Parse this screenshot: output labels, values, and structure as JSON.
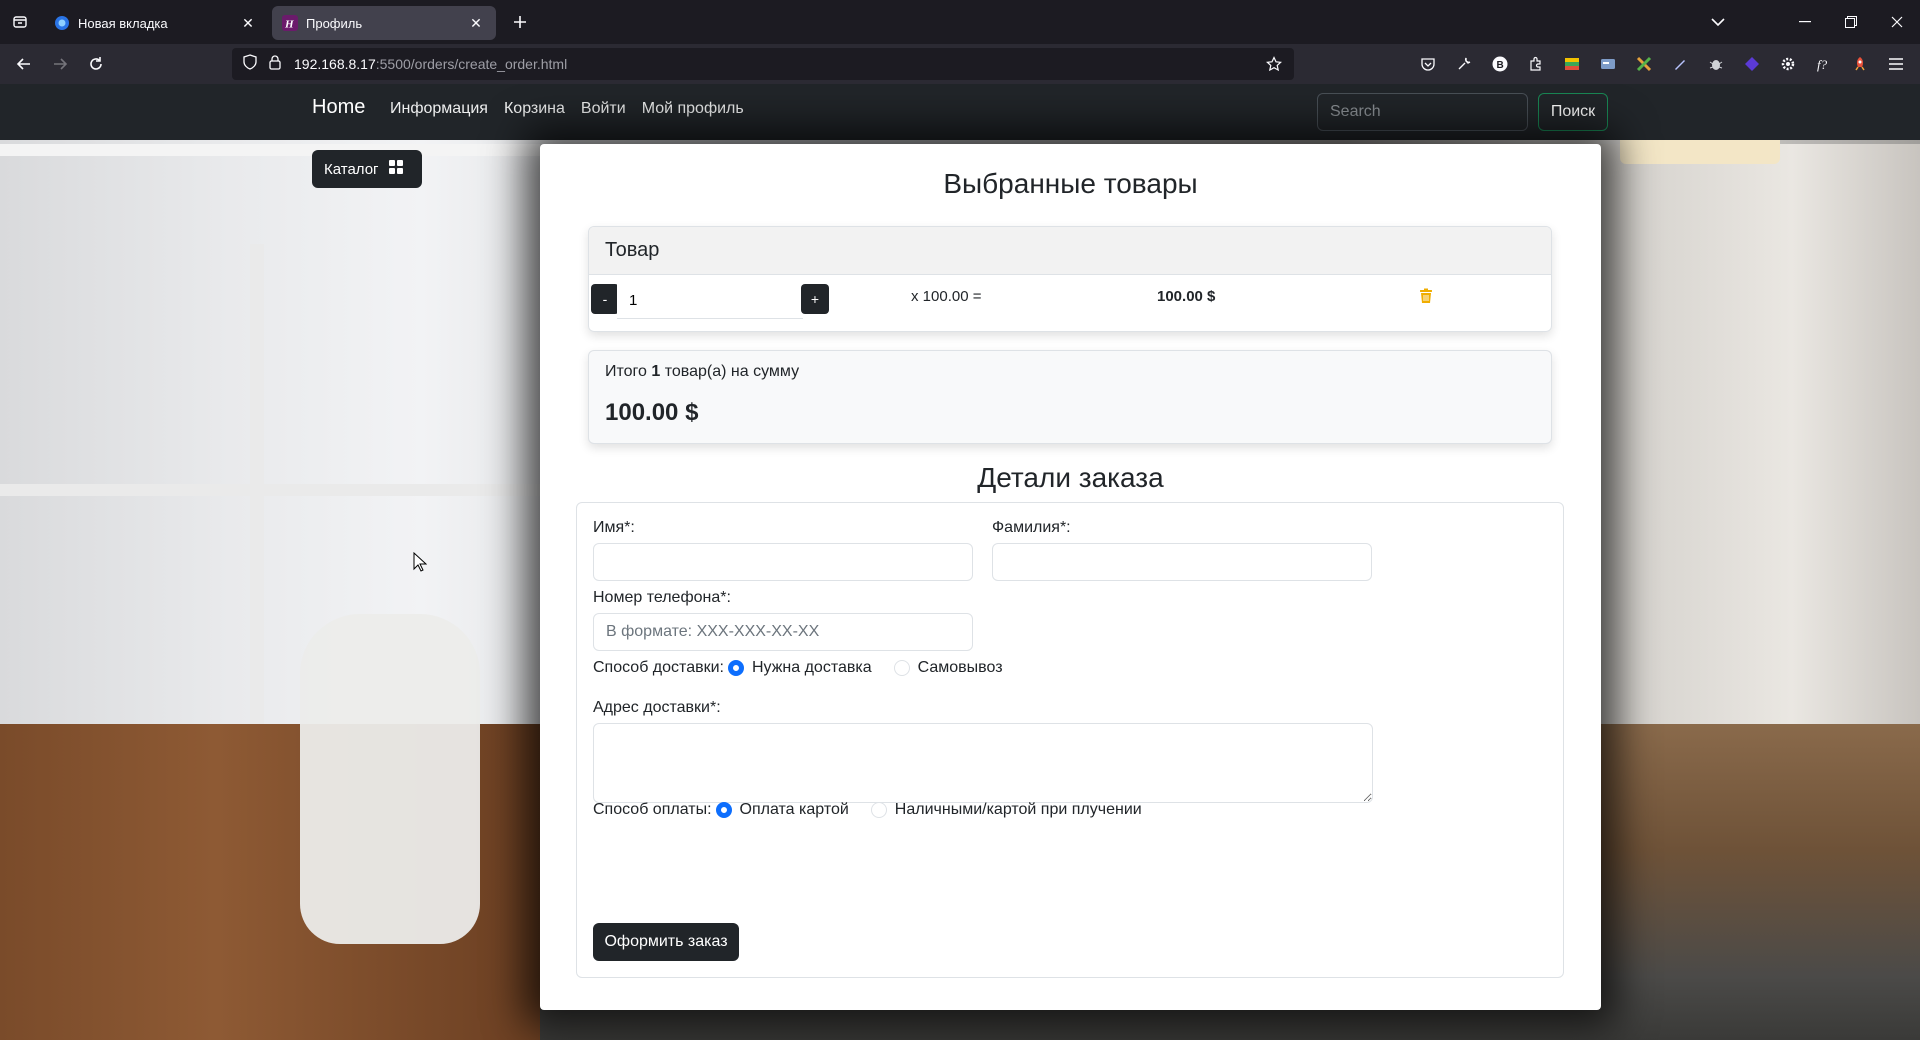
{
  "browser": {
    "tabs": [
      {
        "title": "Новая вкладка",
        "active": false
      },
      {
        "title": "Профиль",
        "active": true
      }
    ],
    "url_host": "192.168.8.17",
    "url_path": ":5500/orders/create_order.html"
  },
  "site_nav": {
    "brand": "Home",
    "links": [
      "Информация",
      "Корзина",
      "Войти",
      "Мой профиль"
    ],
    "search_placeholder": "Search",
    "search_button": "Поиск"
  },
  "catalog_button": "Каталог",
  "selected": {
    "heading": "Выбранные товары",
    "table_header": "Товар",
    "item": {
      "minus": "-",
      "plus": "+",
      "quantity": "1",
      "multiplier": "x 100.00 =",
      "sum": "100.00 $"
    },
    "total_prefix": "Итого",
    "total_count": "1",
    "total_suffix": "товар(а) на сумму",
    "total_amount": "100.00 $"
  },
  "order": {
    "heading": "Детали заказа",
    "first_name_label": "Имя*:",
    "last_name_label": "Фамилия*:",
    "phone_label": "Номер телефона*:",
    "phone_placeholder": "В формате: XXX-XXX-XX-XX",
    "delivery_label": "Способ доставки:",
    "delivery_options": [
      "Нужна доставка",
      "Самовывоз"
    ],
    "delivery_selected": "Нужна доставка",
    "address_label": "Адрес доставки*:",
    "payment_label": "Способ оплаты:",
    "payment_options": [
      "Оплата картой",
      "Наличными/картой при плучении"
    ],
    "payment_selected": "Оплата картой",
    "submit": "Оформить заказ"
  },
  "colors": {
    "navbar": "#212529",
    "accent": "#0d6efd",
    "success_outline": "#198754",
    "trash": "#f0ad00"
  }
}
